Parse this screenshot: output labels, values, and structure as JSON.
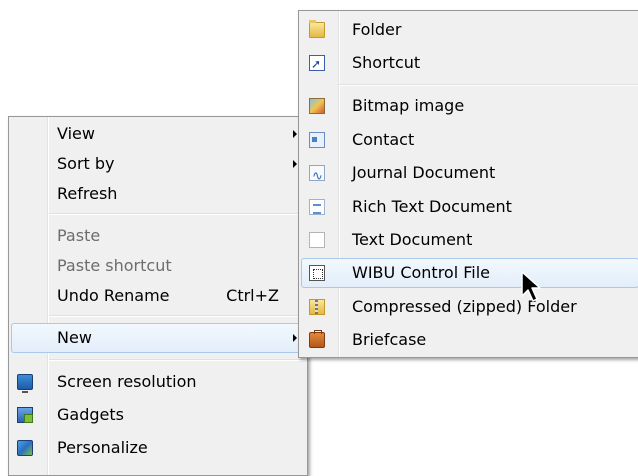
{
  "context_menu": {
    "items": [
      {
        "label": "View",
        "submenu": true
      },
      {
        "label": "Sort by",
        "submenu": true
      },
      {
        "label": "Refresh"
      },
      {
        "label": "Paste",
        "disabled": true
      },
      {
        "label": "Paste shortcut",
        "disabled": true
      },
      {
        "label": "Undo Rename",
        "shortcut": "Ctrl+Z"
      },
      {
        "label": "New",
        "submenu": true,
        "highlighted": true
      },
      {
        "label": "Screen resolution",
        "icon": "screen-resolution-icon"
      },
      {
        "label": "Gadgets",
        "icon": "gadgets-icon"
      },
      {
        "label": "Personalize",
        "icon": "personalize-icon"
      }
    ]
  },
  "new_submenu": {
    "items": [
      {
        "label": "Folder",
        "icon": "folder-icon"
      },
      {
        "label": "Shortcut",
        "icon": "shortcut-icon"
      },
      {
        "label": "Bitmap image",
        "icon": "bitmap-image-icon"
      },
      {
        "label": "Contact",
        "icon": "contact-icon"
      },
      {
        "label": "Journal Document",
        "icon": "journal-document-icon"
      },
      {
        "label": "Rich Text Document",
        "icon": "rich-text-document-icon"
      },
      {
        "label": "Text Document",
        "icon": "text-document-icon"
      },
      {
        "label": "WIBU Control File",
        "icon": "wibu-control-file-icon",
        "highlighted": true
      },
      {
        "label": "Compressed (zipped) Folder",
        "icon": "zipped-folder-icon"
      },
      {
        "label": "Briefcase",
        "icon": "briefcase-icon"
      }
    ]
  },
  "colors": {
    "menu_background": "#f0f0f0",
    "menu_border": "#979797",
    "highlight_border": "#a8c8ec",
    "disabled_text": "#6d6d6d"
  }
}
